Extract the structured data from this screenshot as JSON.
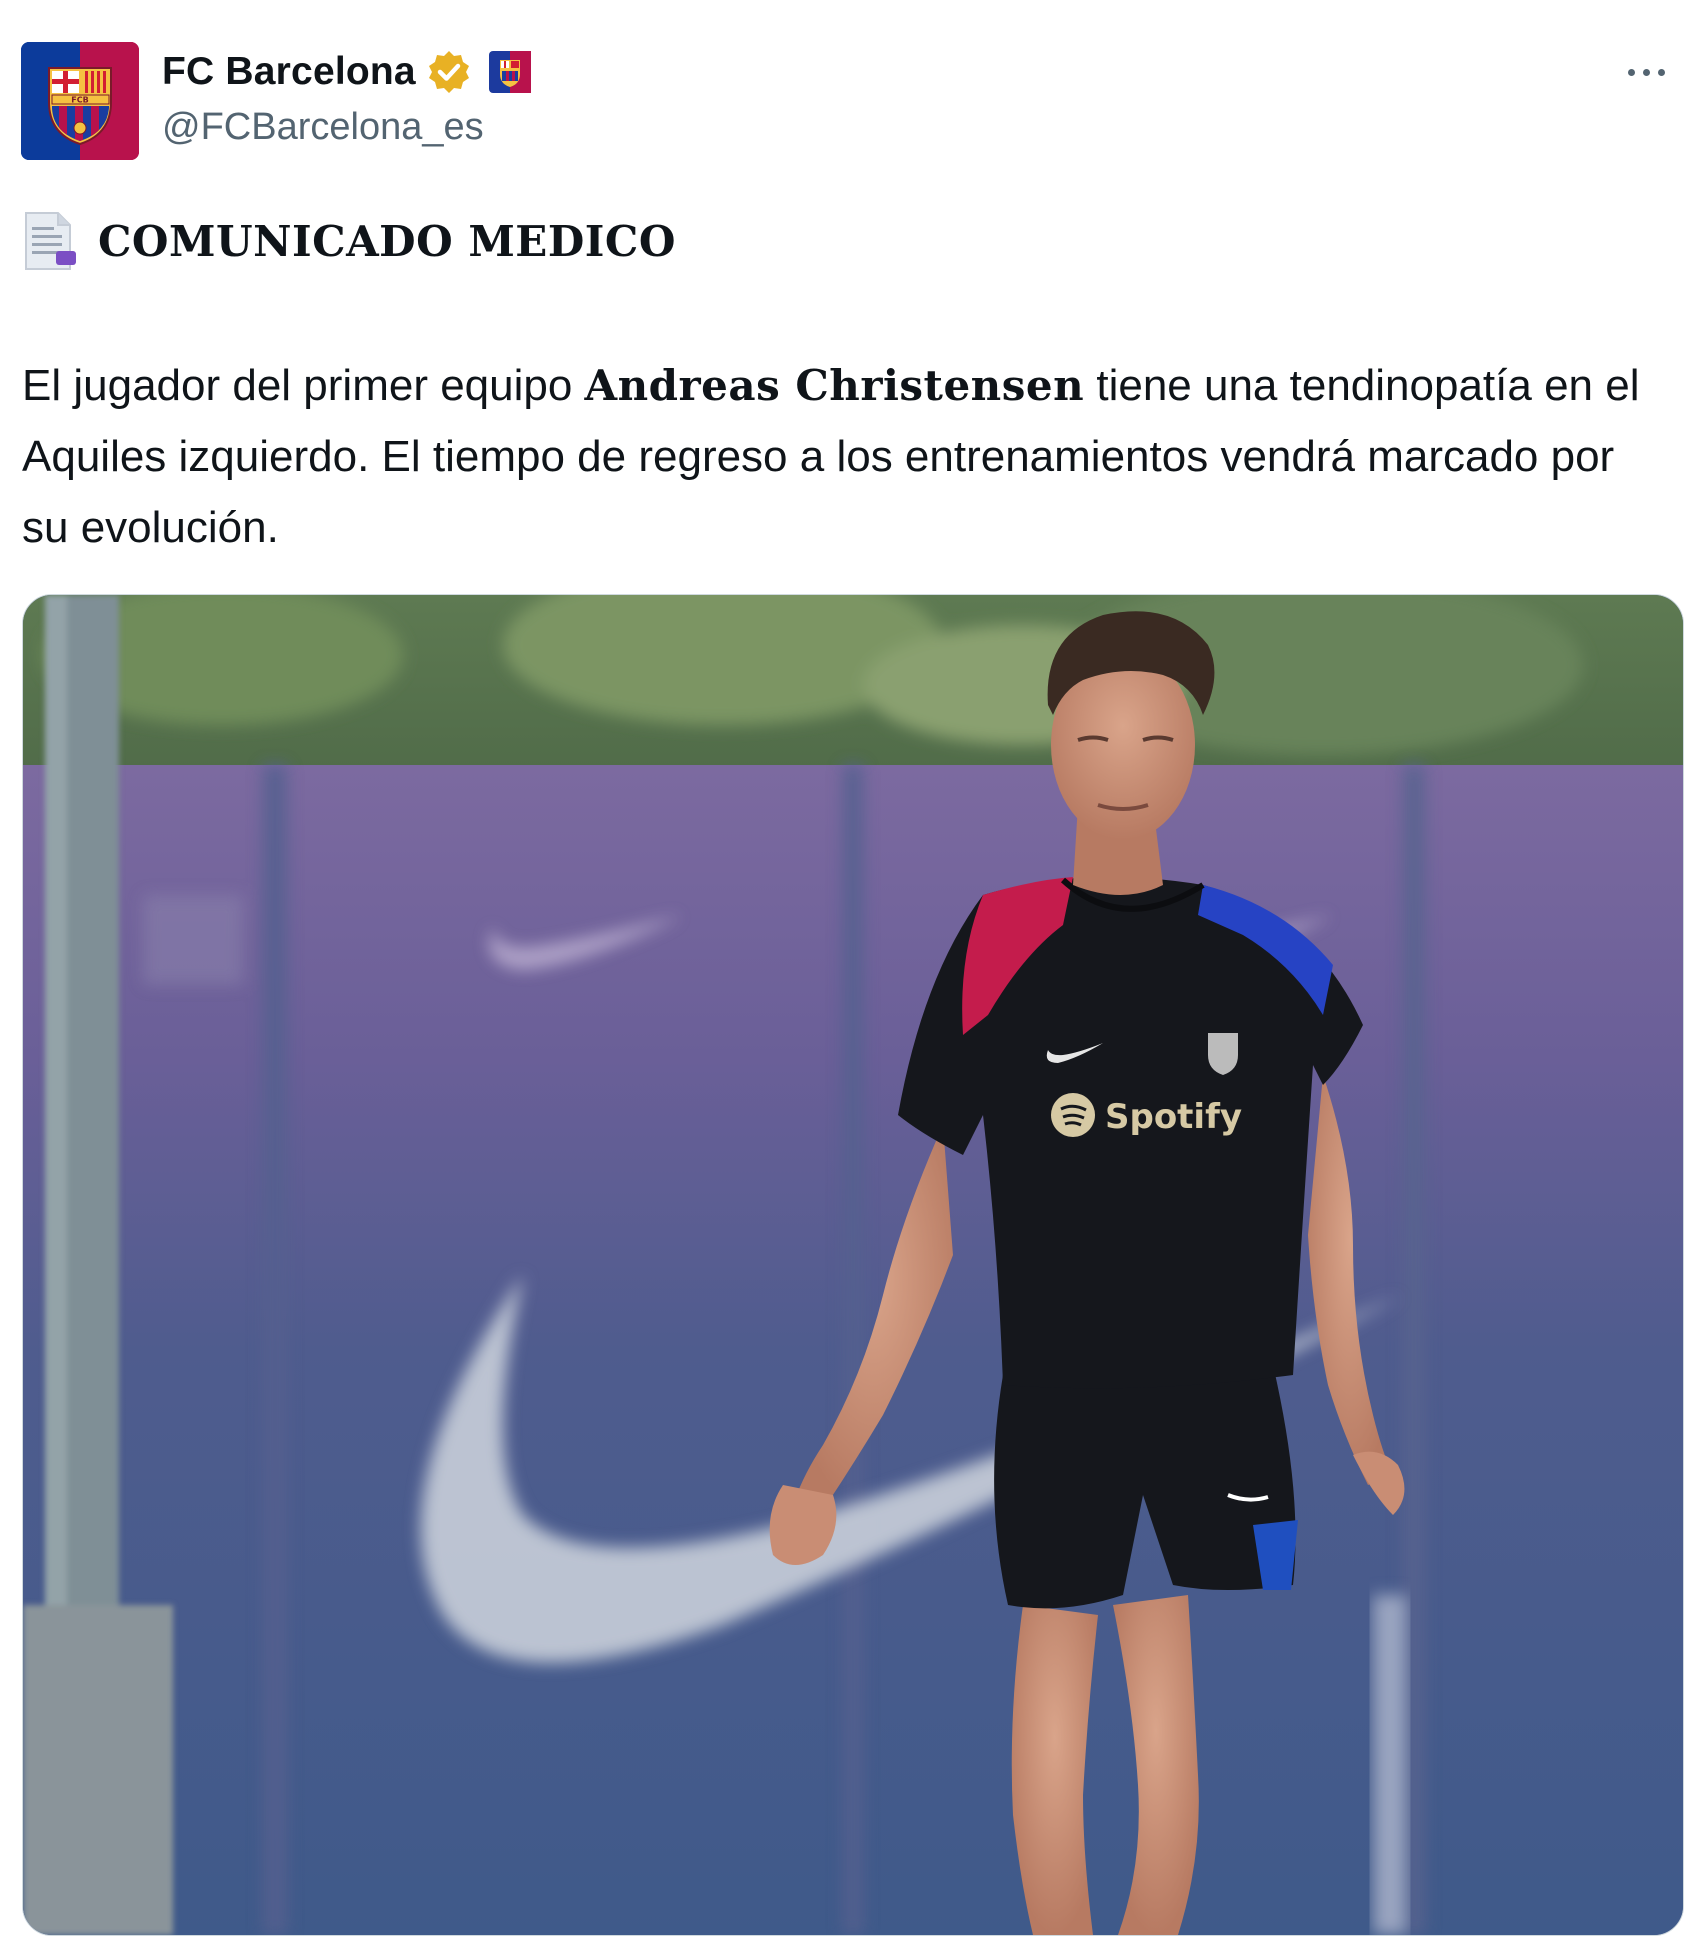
{
  "author": {
    "display_name": "FC Barcelona",
    "handle": "@FCBarcelona_es",
    "avatar_icon": "fcb-crest-icon",
    "verified_icon": "verified-gold-badge-icon",
    "flag_icon": "fcb-flag-emoji-icon"
  },
  "actions": {
    "more_icon": "more-options-icon"
  },
  "post": {
    "headline_icon": "page-facing-up-emoji-icon",
    "headline": "COMUNICADO MEDICO",
    "body_before": "El jugador del primer equipo ",
    "body_bold": "Andreas Christensen",
    "body_after": " tiene una tendinopatía en el Aquiles izquierdo. El tiempo de regreso a los entrenamientos vendrá marcado por su evolución."
  },
  "media": {
    "shirt_sponsor": "Spotify"
  },
  "colors": {
    "text_primary": "#0f1419",
    "text_secondary": "#536471",
    "verified_gold": "#e8b124",
    "club_blue": "#1c3a9e",
    "club_red": "#b8124c",
    "border": "#cfd9de"
  }
}
